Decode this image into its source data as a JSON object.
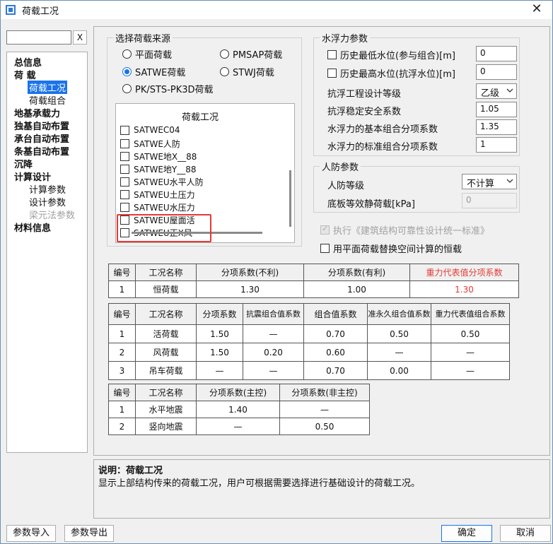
{
  "window": {
    "title": "荷载工况",
    "close_glyph": "✕"
  },
  "search": {
    "value": "",
    "clear_label": "X"
  },
  "tree": [
    {
      "label": "总信息",
      "level": 1
    },
    {
      "label": "荷  载",
      "level": 1
    },
    {
      "label": "荷载工况",
      "level": 2,
      "selected": true
    },
    {
      "label": "荷载组合",
      "level": 2
    },
    {
      "label": "地基承载力",
      "level": 1
    },
    {
      "label": "独基自动布置",
      "level": 1
    },
    {
      "label": "承台自动布置",
      "level": 1
    },
    {
      "label": "条基自动布置",
      "level": 1
    },
    {
      "label": "沉降",
      "level": 1
    },
    {
      "label": "计算设计",
      "level": 1
    },
    {
      "label": "计算参数",
      "level": 2
    },
    {
      "label": "设计参数",
      "level": 2
    },
    {
      "label": "梁元法参数",
      "level": 2,
      "disabled": true
    },
    {
      "label": "材料信息",
      "level": 1
    }
  ],
  "source": {
    "title": "选择荷载来源",
    "options": [
      {
        "label": "平面荷载",
        "checked": false
      },
      {
        "label": "PMSAP荷载",
        "checked": false
      },
      {
        "label": "SATWE荷载",
        "checked": true
      },
      {
        "label": "STWJ荷载",
        "checked": false
      },
      {
        "label": "PK/STS-PK3D荷载",
        "checked": false
      }
    ]
  },
  "load_list": {
    "header": "荷载工况",
    "items": [
      "SATWEC04",
      "SATWE人防",
      "SATWE地X__88",
      "SATWE地Y__88",
      "SATWEU水平人防",
      "SATWEU土压力",
      "SATWEU水压力",
      "SATWEU屋面活",
      "SATWEU正X风"
    ]
  },
  "buoyancy": {
    "title": "水浮力参数",
    "low_water_label": "历史最低水位(参与组合)[m]",
    "low_water_value": "0",
    "high_water_label": "历史最高水位(抗浮水位)[m]",
    "high_water_value": "0",
    "grade_label": "抗浮工程设计等级",
    "grade_value": "乙级",
    "stability_label": "抗浮稳定安全系数",
    "stability_value": "1.05",
    "basic_factor_label": "水浮力的基本组合分项系数",
    "basic_factor_value": "1.35",
    "standard_factor_label": "水浮力的标准组合分项系数",
    "standard_factor_value": "1"
  },
  "civil_defense": {
    "title": "人防参数",
    "grade_label": "人防等级",
    "grade_value": "不计算",
    "load_label": "底板等效静荷载[kPa]",
    "load_value": "0"
  },
  "options": {
    "standard_label": "执行《建筑结构可靠性设计统一标准》",
    "replace_label": "用平面荷载替换空间计算的恒载"
  },
  "table1": {
    "headers": [
      "编号",
      "工况名称",
      "分项系数(不利)",
      "分项系数(有利)",
      "重力代表值分项系数"
    ],
    "rows": [
      [
        "1",
        "恒荷载",
        "1.30",
        "1.00",
        "1.30"
      ]
    ]
  },
  "table2": {
    "headers": [
      "编号",
      "工况名称",
      "分项系数",
      "抗震组合值系数",
      "组合值系数",
      "准永久组合值系数",
      "重力代表值组合系数"
    ],
    "rows": [
      [
        "1",
        "活荷载",
        "1.50",
        "—",
        "0.70",
        "0.50",
        "0.50"
      ],
      [
        "2",
        "风荷载",
        "1.50",
        "0.20",
        "0.60",
        "—",
        "—"
      ],
      [
        "3",
        "吊车荷载",
        "—",
        "—",
        "0.70",
        "0.00",
        "—"
      ]
    ]
  },
  "table3": {
    "headers": [
      "编号",
      "工况名称",
      "分项系数(主控)",
      "分项系数(非主控)"
    ],
    "rows": [
      [
        "1",
        "水平地震",
        "1.40",
        "—"
      ],
      [
        "2",
        "竖向地震",
        "—",
        "0.50"
      ]
    ]
  },
  "description": {
    "title": "说明：荷载工况",
    "text": "显示上部结构传来的荷载工况，用户可根据需要选择进行基础设计的荷载工况。"
  },
  "buttons": {
    "import": "参数导入",
    "export": "参数导出",
    "ok": "确定",
    "cancel": "取消"
  },
  "colors": {
    "accent": "#1a73e8",
    "highlight": "#e53935"
  }
}
